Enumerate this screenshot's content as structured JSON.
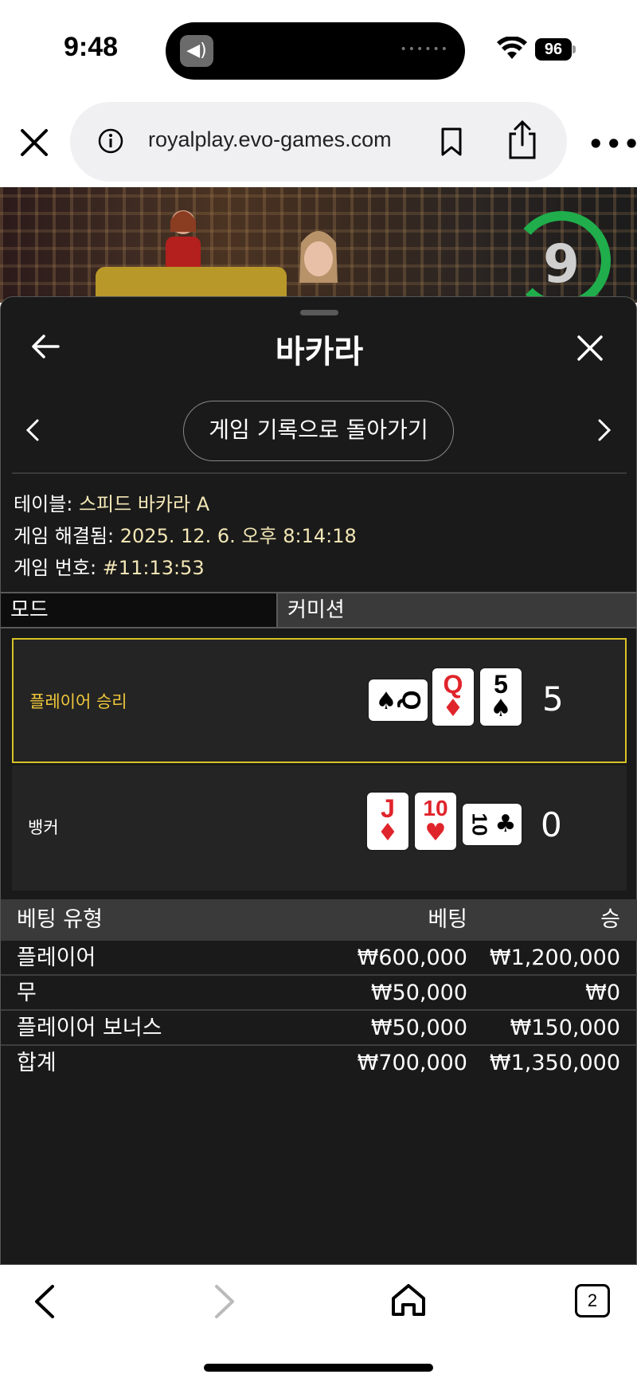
{
  "status": {
    "time": "9:48",
    "battery": "96"
  },
  "browser": {
    "url": "royalplay.evo-games.com",
    "tab_count": "2"
  },
  "video": {
    "countdown": "9"
  },
  "sheet": {
    "title": "바카라",
    "back_to_history": "게임 기록으로 돌아가기",
    "table": {
      "label": "테이블:",
      "value": "스피드 바카라 A"
    },
    "resolved": {
      "label": "게임 해결됨:",
      "value": "2025. 12. 6. 오후 8:14:18"
    },
    "game_no": {
      "label": "게임 번호:",
      "value": "#11:13:53"
    },
    "mode_label": "모드",
    "mode_value": "커미션"
  },
  "hands": {
    "player": {
      "label": "플레이어 승리",
      "score": "5",
      "cards": [
        {
          "rank": "Q",
          "suit": "♠",
          "color": "#000000",
          "orientation": "horizontal"
        },
        {
          "rank": "Q",
          "suit": "♦",
          "color": "#e0242b"
        },
        {
          "rank": "5",
          "suit": "♠",
          "color": "#000000"
        }
      ]
    },
    "banker": {
      "label": "뱅커",
      "score": "0",
      "cards": [
        {
          "rank": "J",
          "suit": "♦",
          "color": "#e0242b"
        },
        {
          "rank": "10",
          "suit": "♥",
          "color": "#e0242b"
        },
        {
          "rank": "10",
          "suit": "♣",
          "color": "#000000",
          "orientation": "horizontal"
        }
      ]
    }
  },
  "bets": {
    "headers": {
      "type": "베팅 유형",
      "bet": "베팅",
      "win": "승"
    },
    "rows": [
      {
        "type": "플레이어",
        "bet": "₩600,000",
        "win": "₩1,200,000"
      },
      {
        "type": "무",
        "bet": "₩50,000",
        "win": "₩0"
      },
      {
        "type": "플레이어 보너스",
        "bet": "₩50,000",
        "win": "₩150,000"
      }
    ],
    "total": {
      "type": "합계",
      "bet": "₩700,000",
      "win": "₩1,350,000"
    }
  },
  "colors": {
    "win_border": "#d8c326",
    "win_label": "#f0c83a",
    "sheet_bg": "#1a1a1a",
    "timer_green": "#1fae4b"
  }
}
